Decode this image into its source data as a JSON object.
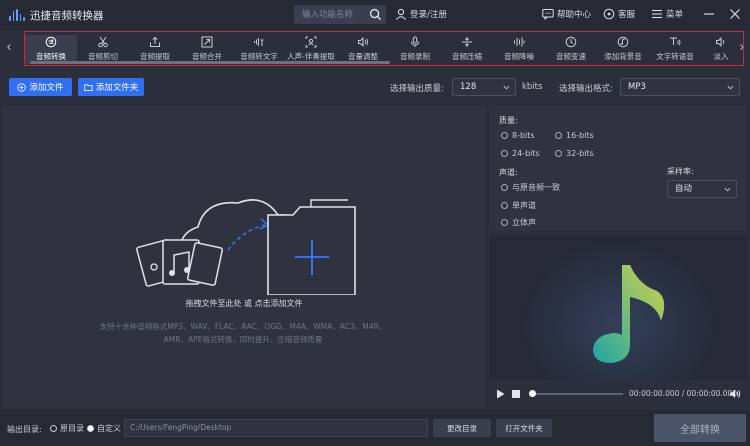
{
  "app": {
    "title": "迅捷音频转换器"
  },
  "search": {
    "placeholder": "输入功能名称"
  },
  "header": {
    "login": "登录/注册",
    "help": "帮助中心",
    "service": "客服",
    "menu": "菜单"
  },
  "tools": [
    {
      "label": "音频转换",
      "icon": "convert-icon",
      "active": true
    },
    {
      "label": "音频剪切",
      "icon": "scissors-icon"
    },
    {
      "label": "音频提取",
      "icon": "extract-icon"
    },
    {
      "label": "音频合并",
      "icon": "merge-icon"
    },
    {
      "label": "音频转文字",
      "icon": "audio-to-text-icon"
    },
    {
      "label": "人声-伴奏提取",
      "icon": "vocal-extract-icon"
    },
    {
      "label": "音量调整",
      "icon": "volume-icon"
    },
    {
      "label": "音频录制",
      "icon": "microphone-icon"
    },
    {
      "label": "音频压缩",
      "icon": "compress-icon"
    },
    {
      "label": "音频降噪",
      "icon": "denoise-icon"
    },
    {
      "label": "音频变速",
      "icon": "speed-icon"
    },
    {
      "label": "添加背景音",
      "icon": "background-music-icon"
    },
    {
      "label": "文字转语音",
      "icon": "text-to-speech-icon"
    },
    {
      "label": "淡入",
      "icon": "fade-in-icon"
    }
  ],
  "actions": {
    "add_file": "添加文件",
    "add_folder": "添加文件夹",
    "quality_label": "选择输出质量:",
    "quality_value": "128",
    "quality_unit": "kbits",
    "format_label": "选择输出格式:",
    "format_value": "MP3"
  },
  "dropzone": {
    "main_hint": "拖拽文件至此处 或 点击添加文件",
    "sub_hint": "支持十余种音频格式MP3、WAV、FLAC、AAC、OGG、M4A、WMA、AC3、M4R、AMR、APE格式转换，同时提升、压缩音频质量"
  },
  "settings": {
    "quality_title": "质量:",
    "bits": [
      "8-bits",
      "16-bits",
      "24-bits",
      "32-bits"
    ],
    "channel_title": "声道:",
    "channels": [
      "与原音频一致",
      "单声道",
      "立体声"
    ],
    "samplerate_title": "采样率:",
    "samplerate_value": "自动"
  },
  "player": {
    "time": "00:00:00.000 / 00:00:00.000"
  },
  "bottom": {
    "output_label": "输出目录:",
    "option_original": "原目录",
    "option_custom": "自定义",
    "path": "C:/Users/FengPing/Desktop",
    "change_dir": "更改目录",
    "open_folder": "打开文件夹",
    "convert_all": "全部转换"
  },
  "colors": {
    "accent": "#2f6ff1",
    "highlight_border": "#d0263a",
    "background": "#2b2f3c"
  }
}
